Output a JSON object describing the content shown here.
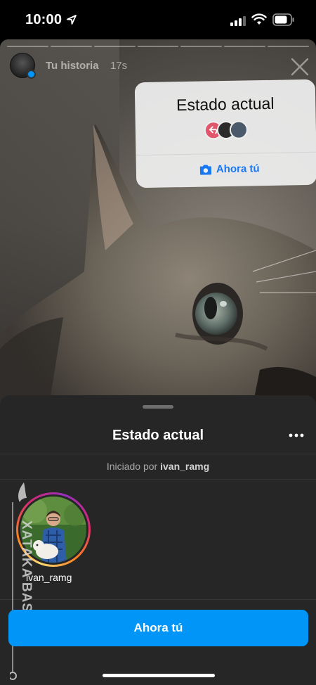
{
  "status_bar": {
    "time": "10:00"
  },
  "story": {
    "username": "Tu historia",
    "elapsed": "17s",
    "segments": 7,
    "sticker": {
      "title": "Estado actual",
      "action_label": "Ahora tú"
    }
  },
  "sheet": {
    "title": "Estado actual",
    "started_by_prefix": "Iniciado por",
    "started_by_user": "ivan_ramg",
    "participants": [
      {
        "username": "ivan_ramg"
      }
    ],
    "cta_label": "Ahora tú"
  },
  "watermark": {
    "text": "XATAKA BASICS"
  },
  "colors": {
    "accent": "#0095f6",
    "sheet_bg": "#262626",
    "sticker_action": "#1877f2"
  }
}
